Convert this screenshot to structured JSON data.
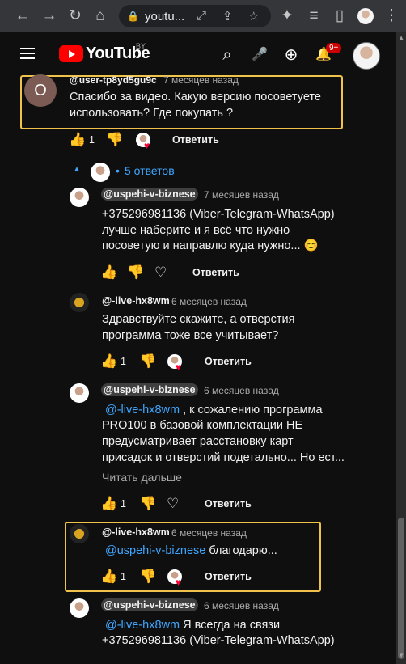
{
  "browser": {
    "url": "youtu...",
    "back": "←",
    "forward": "→",
    "reload": "↻",
    "home": "⌂",
    "lock": "🔒",
    "omni_icons": [
      "⤢",
      "⇪",
      "☆"
    ],
    "ext_icons": [
      "✦",
      "≡",
      "▯"
    ],
    "menu": "⋮"
  },
  "youtube": {
    "logo_text": "YouTube",
    "country": "BY",
    "notif_badge": "9+",
    "icons": {
      "search": "⌕",
      "mic": "🎤",
      "create": "⊕",
      "bell": "🔔"
    }
  },
  "top_comment": {
    "avatar_letter": "O",
    "author": "@user-tp8yd5gu9c",
    "time": "7 месяцев назад",
    "text_line1": "Спасибо за видео. Какую версию посоветуете",
    "text_line2": "использовать? Где покупать ?",
    "likes": "1",
    "reply": "Ответить"
  },
  "replies_toggle": {
    "label": "5 ответов"
  },
  "replies": [
    {
      "author": "@uspehi-v-biznese",
      "time": "7 месяцев назад",
      "lines": [
        "+375296981136 (Viber-Telegram-WhatsApp)",
        "лучше наберите и я всё что нужно",
        "посоветую и направлю куда нужно... 😊"
      ],
      "likes": "",
      "reply": "Ответить"
    },
    {
      "author": "@-live-hx8wm",
      "time": "6 месяцев назад",
      "lines": [
        "Здравствуйте скажите, а отверстия",
        "программа тоже все учитывает?"
      ],
      "likes": "1",
      "reply": "Ответить"
    },
    {
      "author": "@uspehi-v-biznese",
      "time": "6 месяцев назад",
      "mention": "@-live-hx8wm",
      "lines": [
        ", к сожалению программа",
        "PRO100 в базовой комплектации НЕ",
        "предусматривает расстановку карт",
        "присадок и отверстий подетально... Но ест..."
      ],
      "read_more": "Читать дальше",
      "likes": "1",
      "reply": "Ответить"
    },
    {
      "author": "@-live-hx8wm",
      "time": "6 месяцев назад",
      "mention": "@uspehi-v-biznese",
      "lines": [
        "благодарю..."
      ],
      "likes": "1",
      "reply": "Ответить"
    },
    {
      "author": "@uspehi-v-biznese",
      "time": "6 месяцев назад",
      "mention": "@-live-hx8wm",
      "lines": [
        "Я всегда на связи",
        "+375296981136 (Viber-Telegram-WhatsApp)"
      ]
    }
  ],
  "colors": {
    "highlight": "#f0c14b",
    "link": "#3ea6ff",
    "bg": "#0f0f0f"
  }
}
